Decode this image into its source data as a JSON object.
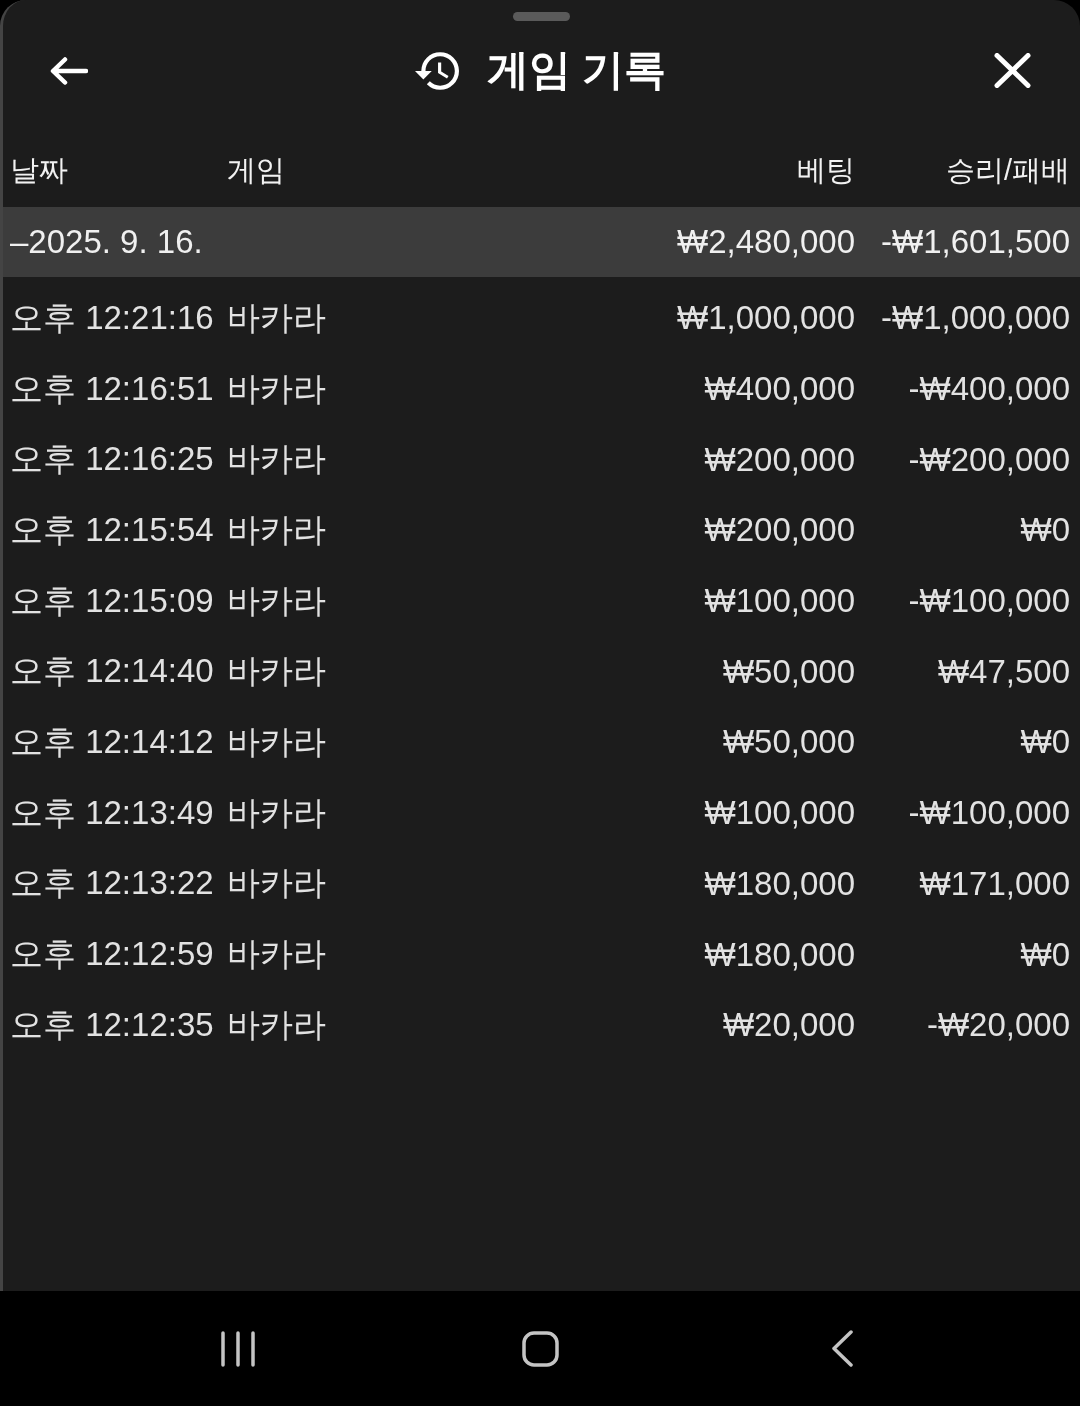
{
  "sheet": {
    "title": "게임 기록"
  },
  "table": {
    "columns": [
      "날짜",
      "게임",
      "베팅",
      "승리/패배"
    ],
    "groups": [
      {
        "date": "–2025. 9. 16.",
        "bet": "₩2,480,000",
        "result": "-₩1,601,500",
        "rows": [
          {
            "time": "오후 12:21:16",
            "game": "바카라",
            "bet": "₩1,000,000",
            "result": "-₩1,000,000"
          },
          {
            "time": "오후 12:16:51",
            "game": "바카라",
            "bet": "₩400,000",
            "result": "-₩400,000"
          },
          {
            "time": "오후 12:16:25",
            "game": "바카라",
            "bet": "₩200,000",
            "result": "-₩200,000"
          },
          {
            "time": "오후 12:15:54",
            "game": "바카라",
            "bet": "₩200,000",
            "result": "₩0"
          },
          {
            "time": "오후 12:15:09",
            "game": "바카라",
            "bet": "₩100,000",
            "result": "-₩100,000"
          },
          {
            "time": "오후 12:14:40",
            "game": "바카라",
            "bet": "₩50,000",
            "result": "₩47,500"
          },
          {
            "time": "오후 12:14:12",
            "game": "바카라",
            "bet": "₩50,000",
            "result": "₩0"
          },
          {
            "time": "오후 12:13:49",
            "game": "바카라",
            "bet": "₩100,000",
            "result": "-₩100,000"
          },
          {
            "time": "오후 12:13:22",
            "game": "바카라",
            "bet": "₩180,000",
            "result": "₩171,000"
          },
          {
            "time": "오후 12:12:59",
            "game": "바카라",
            "bet": "₩180,000",
            "result": "₩0"
          },
          {
            "time": "오후 12:12:35",
            "game": "바카라",
            "bet": "₩20,000",
            "result": "-₩20,000"
          }
        ]
      }
    ]
  }
}
